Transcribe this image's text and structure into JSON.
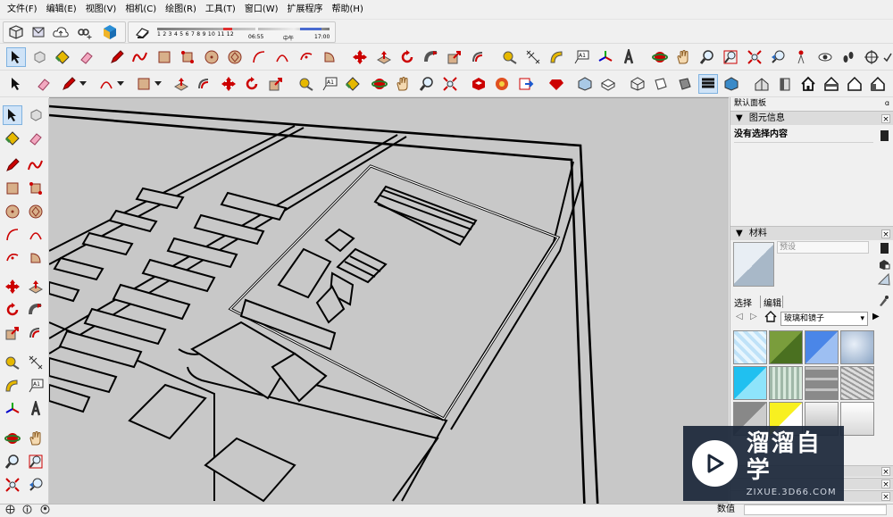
{
  "menu": [
    "文件(F)",
    "编辑(E)",
    "视图(V)",
    "相机(C)",
    "绘图(R)",
    "工具(T)",
    "窗口(W)",
    "扩展程序",
    "帮助(H)"
  ],
  "shadow": {
    "months": "1 2 3 4 5 6 7 8 9 10 11 12",
    "time_start": "06:55",
    "time_mid": "中午",
    "time_end": "17:00"
  },
  "panel": {
    "title": "默认面板",
    "entity_info": {
      "title": "图元信息",
      "status": "没有选择内容"
    },
    "materials": {
      "title": "材料",
      "preview_name": "预设",
      "tab_select": "选择",
      "tab_edit": "编辑",
      "library": "玻璃和镜子"
    }
  },
  "statusbar": {
    "measure_label": "数值"
  },
  "watermark": {
    "brand": "溜溜自学",
    "url": "ZIXUE.3D66.COM"
  },
  "colors": {
    "viewport_bg": "#c8c8c8",
    "edge": "#000000",
    "select_highlight": "#cfe3f7",
    "watermark_bg": "#1a2638"
  },
  "icons": {
    "toolbar_row1": [
      "select-arrow-icon",
      "eraser-icon",
      "paint-bucket-icon",
      "eraser-pink-icon",
      "pencil-icon",
      "freehand-icon",
      "rectangle-icon",
      "rotated-rectangle-icon",
      "circle-icon",
      "polygon-icon",
      "arc-icon",
      "pie-icon",
      "move-icon",
      "push-pull-icon",
      "rotate-icon",
      "follow-me-icon",
      "scale-icon",
      "offset-icon",
      "tape-measure-icon",
      "dimension-icon",
      "protractor-icon",
      "text-icon",
      "axes-icon",
      "3d-text-icon",
      "orbit-icon",
      "pan-icon",
      "zoom-icon",
      "zoom-extents-icon",
      "position-camera-icon",
      "walk-icon",
      "look-around-icon",
      "section-plane-icon"
    ],
    "left_toolbar": [
      "select-arrow-icon",
      "component-icon",
      "paint-bucket-icon",
      "eraser-icon",
      "pencil-icon",
      "freehand-icon",
      "rectangle-icon",
      "rotated-rectangle-icon",
      "circle-icon",
      "polygon-icon",
      "arc-icon",
      "pie-icon",
      "move-icon",
      "push-pull-icon",
      "rotate-icon",
      "follow-me-icon",
      "scale-icon",
      "offset-icon",
      "tape-measure-icon",
      "dimension-icon",
      "protractor-icon",
      "text-icon",
      "axes-icon",
      "3d-text-icon",
      "orbit-icon",
      "pan-icon",
      "zoom-icon",
      "zoom-window-icon",
      "zoom-extents-icon",
      "previous-view-icon"
    ]
  }
}
